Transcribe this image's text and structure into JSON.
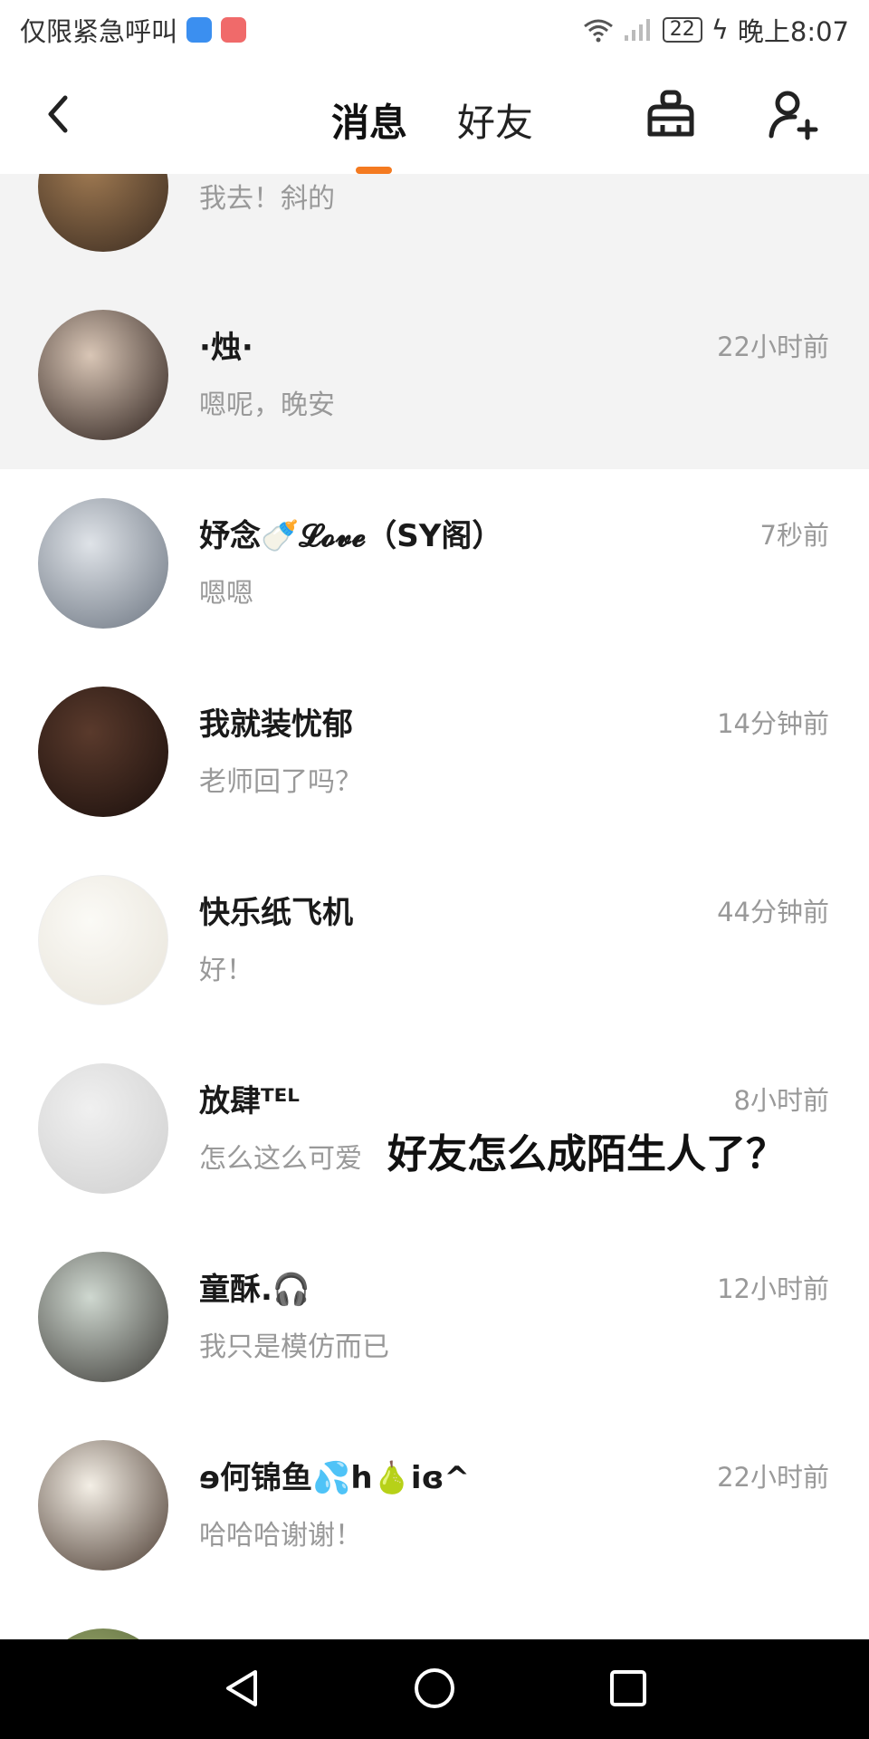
{
  "status_bar": {
    "left_text": "仅限紧急呼叫",
    "battery": "22",
    "time": "晚上8:07"
  },
  "nav": {
    "tabs": [
      "消息",
      "好友"
    ],
    "active_tab": "消息",
    "accent_color": "#f47a20"
  },
  "conversations": [
    {
      "name": "",
      "preview": "我去！斜的",
      "time": "",
      "pinned": true,
      "avatar_colors": [
        "#a07a52",
        "#3a2b20"
      ]
    },
    {
      "name": "·烛·",
      "preview": "嗯呢，晚安",
      "time": "22小时前",
      "pinned": true,
      "avatar_colors": [
        "#d9c6b6",
        "#2a1e1a"
      ]
    },
    {
      "name": "妤念🍼𝓛𝓸𝓿𝓮（SY阁）",
      "preview": "嗯嗯",
      "time": "7秒前",
      "pinned": false,
      "avatar_colors": [
        "#dfe3e8",
        "#6b7480"
      ]
    },
    {
      "name": "我就装忧郁",
      "preview": "老师回了吗？",
      "time": "14分钟前",
      "pinned": false,
      "avatar_colors": [
        "#5a3a2c",
        "#1a0f0c"
      ]
    },
    {
      "name": "快乐纸飞机",
      "preview": "好！",
      "time": "44分钟前",
      "pinned": false,
      "avatar_colors": [
        "#fbfaf6",
        "#e8e4da"
      ]
    },
    {
      "name": "放肆ᵀᴱᴸ",
      "preview": "怎么这么可爱",
      "time": "8小时前",
      "pinned": false,
      "avatar_colors": [
        "#f0f0f0",
        "#cfcfcf"
      ]
    },
    {
      "name": "童酥.🎧",
      "preview": "我只是模仿而已",
      "time": "12小时前",
      "pinned": false,
      "avatar_colors": [
        "#cfd8d0",
        "#3c3a36"
      ]
    },
    {
      "name": "ɘ何锦鱼💦h🍐iɞ^",
      "preview": "哈哈哈谢谢！",
      "time": "22小时前",
      "pinned": false,
      "avatar_colors": [
        "#f4efe6",
        "#4a3a30"
      ]
    },
    {
      "name": "",
      "preview": "",
      "time": "",
      "pinned": false,
      "avatar_colors": [
        "#9aa86a",
        "#4b5a34"
      ]
    }
  ],
  "overlay_caption": "好友怎么成陌生人了？",
  "icons": {
    "back": "chevron-left-icon",
    "clean": "broom-basket-icon",
    "add_friend": "add-user-icon",
    "sys_back": "triangle-back-icon",
    "sys_home": "circle-home-icon",
    "sys_recents": "square-recents-icon"
  }
}
